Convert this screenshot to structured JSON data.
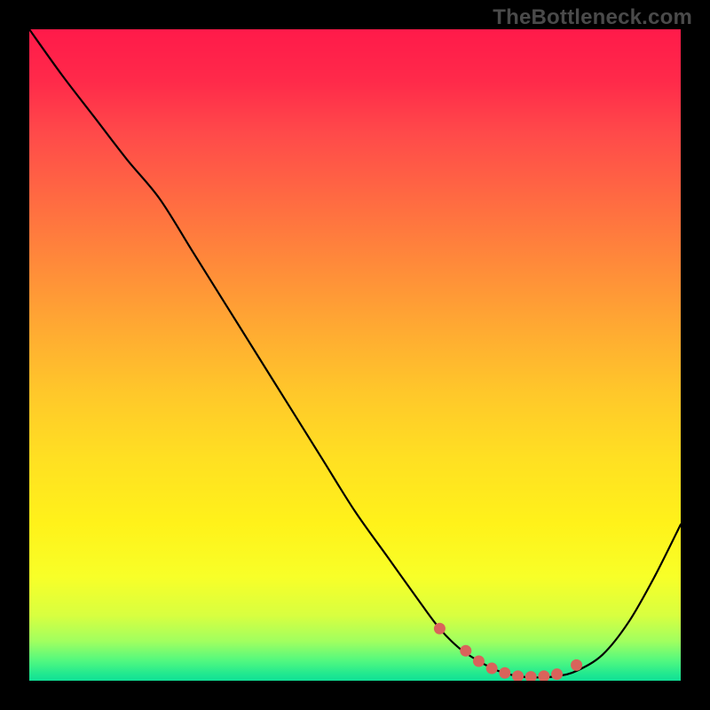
{
  "watermark": "TheBottleneck.com",
  "chart_data": {
    "type": "line",
    "title": "",
    "xlabel": "",
    "ylabel": "",
    "xlim": [
      0,
      100
    ],
    "ylim": [
      0,
      100
    ],
    "grid": false,
    "legend": false,
    "x": [
      0,
      5,
      10,
      15,
      20,
      25,
      30,
      35,
      40,
      45,
      50,
      55,
      60,
      63,
      66,
      69,
      72,
      75,
      78,
      81,
      84,
      88,
      92,
      96,
      100
    ],
    "values": [
      100,
      93,
      86.5,
      80,
      74,
      66,
      58,
      50,
      42,
      34,
      26,
      19,
      12,
      8,
      5,
      3,
      1.5,
      0.7,
      0.5,
      0.7,
      1.5,
      4,
      9,
      16,
      24
    ],
    "markers": {
      "x": [
        63,
        67,
        69,
        71,
        73,
        75,
        77,
        79,
        81,
        84
      ],
      "y": [
        8,
        4.6,
        3,
        1.9,
        1.2,
        0.7,
        0.6,
        0.7,
        1,
        2.4
      ],
      "color": "#d9635b"
    },
    "note": "Values are read from the plot as percentages of plot height/width (0-100). The curve descends steeply from top-left, reaches a minimum near x≈77, then rises toward the right edge."
  }
}
